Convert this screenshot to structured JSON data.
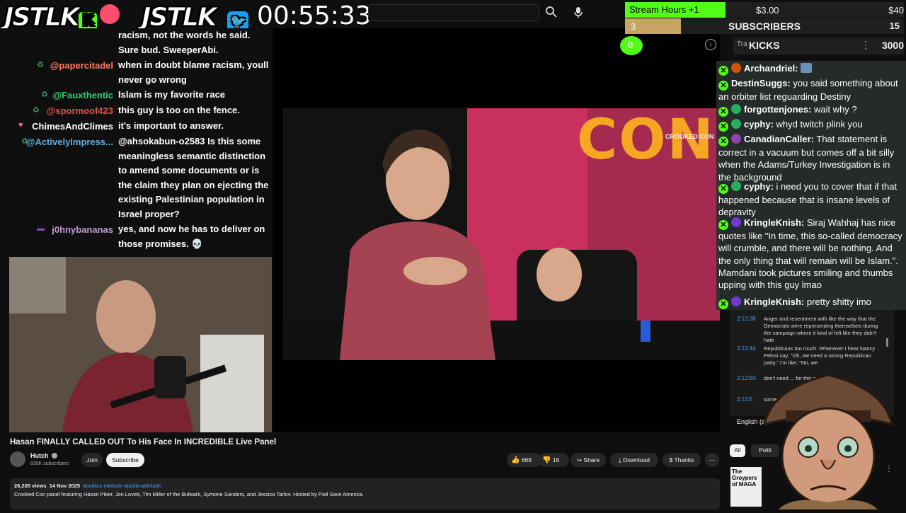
{
  "overlay": {
    "logo1": "JSTLK",
    "logo2": "JSTLK_",
    "k_badge": "K",
    "timer": "00:55:33"
  },
  "yt_top": {
    "search_icon": "search-icon",
    "mic_icon": "mic-icon"
  },
  "widgets": {
    "stream_hours_label": "Stream Hours +1",
    "stream_hours_amount": "$3.00",
    "stream_hours_goal": "$40",
    "subs_count": "3",
    "subs_label": "SUBSCRIBERS",
    "subs_goal": "15",
    "kicks_count": "0",
    "kicks_label": "KICKS",
    "kicks_goal": "3000",
    "kicks_partial": "Tra",
    "colors": {
      "green": "#53fc18",
      "gold": "#c8a565",
      "dark": "#1f1f1f"
    }
  },
  "left_chat": [
    {
      "name": "",
      "msg": "racism, not the words he said. Sure bud. SweeperAbi.",
      "color": "#ffffff"
    },
    {
      "name": "@papercitadel",
      "msg": "when in doubt blame racism, youll never go wrong",
      "color": "#ff7b5b"
    },
    {
      "name": "@Fauxthentic",
      "msg": "Islam is my favorite race",
      "color": "#2ecc71"
    },
    {
      "name": "@spormoof423",
      "msg": "this guy is too on the fence.",
      "color": "#d9534f"
    },
    {
      "name": "ChimesAndClimes",
      "msg": "it's important to answer.",
      "color": "#ffffff"
    },
    {
      "name": "@ActivelyImpress...",
      "msg": "@ahsokabun-o2583 Is this some meaningless semantic distinction to amend some documents or is the claim they plan on ejecting the existing Palestinian population in Israel proper?",
      "color": "#5dade2"
    },
    {
      "name": "j0hnybananas",
      "msg": "yes, and now he has to deliver on those promises. 💀",
      "color": "#c39bd3"
    }
  ],
  "video_overlay_text": {
    "con": "CON",
    "crooked_con": "CROOKED CON"
  },
  "right_chat": [
    {
      "name": "Archandriel:",
      "msg": "",
      "avatar": "#d35400"
    },
    {
      "name": "DestinSuggs:",
      "msg": "you said something about an orbiter list reguarding Destiny",
      "avatar": ""
    },
    {
      "name": "forgottenjones:",
      "msg": "wait why ?",
      "avatar": "#27ae60"
    },
    {
      "name": "cyphy:",
      "msg": "whyd twitch plink you",
      "avatar": "#27ae60"
    },
    {
      "name": "CanadianCaller:",
      "msg": "That statement is correct in a vacuum but comes off a bit silly when the Adams/Turkey Investigation is in the background",
      "avatar": "#8e44ad"
    },
    {
      "name": "cyphy:",
      "msg": "i need you to cover that if that happened because that is insane levels of depravity",
      "avatar": "#27ae60"
    },
    {
      "name": "KringleKnish:",
      "msg": "Siraj Wahhaj has nice quotes like \"In time, this so-called democracy will crumble, and there will be nothing. And the only thing that will remain will be Islam.\". Mamdani took pictures smiling and thumbs upping with this guy lmao",
      "avatar": "#6c3bd1"
    },
    {
      "name": "KringleKnish:",
      "msg": "pretty shitty imo",
      "avatar": "#6c3bd1"
    }
  ],
  "transcript": [
    {
      "time": "2:12:38",
      "text": "Anger and resentment with like the way that the Democrats were representing themselves during the campaign where it kind of felt like they didn't hate"
    },
    {
      "time": "2:12:44",
      "text": "Republicans too much. Whenever I hear Nancy Pelosi say, \"Oh, we need a strong Republican party.\" I'm like, \"No, we"
    },
    {
      "time": "2:12:50",
      "text": "don't need ... for this country.\""
    },
    {
      "time": "2:12:5",
      "text": "some..."
    }
  ],
  "transcript_lang": "English (au",
  "side_chips": [
    "All",
    "Politi"
  ],
  "video": {
    "title": "Hasan FINALLY CALLED OUT To His Face In INCREDIBLE Live Panel",
    "channel": "Hutch",
    "subscribers": "839K subscribers",
    "join_label": "Join",
    "subscribe_label": "Subscribe",
    "likes": "669",
    "dislikes": "16",
    "share_label": "Share",
    "download_label": "Download",
    "thanks_label": "Thanks",
    "views": "26,205 views",
    "date": "14 Nov 2025",
    "tags": "#politics #debate #politicaldebate",
    "description": "Crooked Con panel featuring Hasan Piker, Jon Lovett, Tim Miller of the Bulwark, Symone Sanders, and Jessica Tarlov. Hosted by Pod Save America."
  },
  "mascot_sign": "The Groypers of MAGA"
}
